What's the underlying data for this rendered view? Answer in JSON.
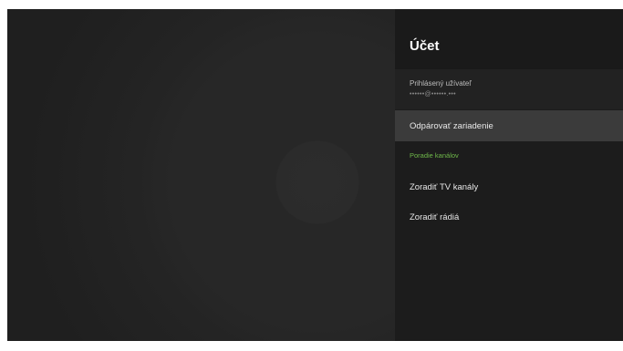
{
  "panel": {
    "title": "Účet",
    "account": {
      "label": "Prihlásený užívateľ",
      "value": "••••••@••••••.•••"
    },
    "unpair_label": "Odpárovať zariadenie",
    "section_header": "Poradie kanálov",
    "sort_tv_label": "Zoradiť TV kanály",
    "sort_radio_label": "Zoradiť rádiá"
  },
  "colors": {
    "accent": "#6fb84a",
    "panel_bg": "#1c1c1c",
    "focus_bg": "#3b3b3b"
  }
}
